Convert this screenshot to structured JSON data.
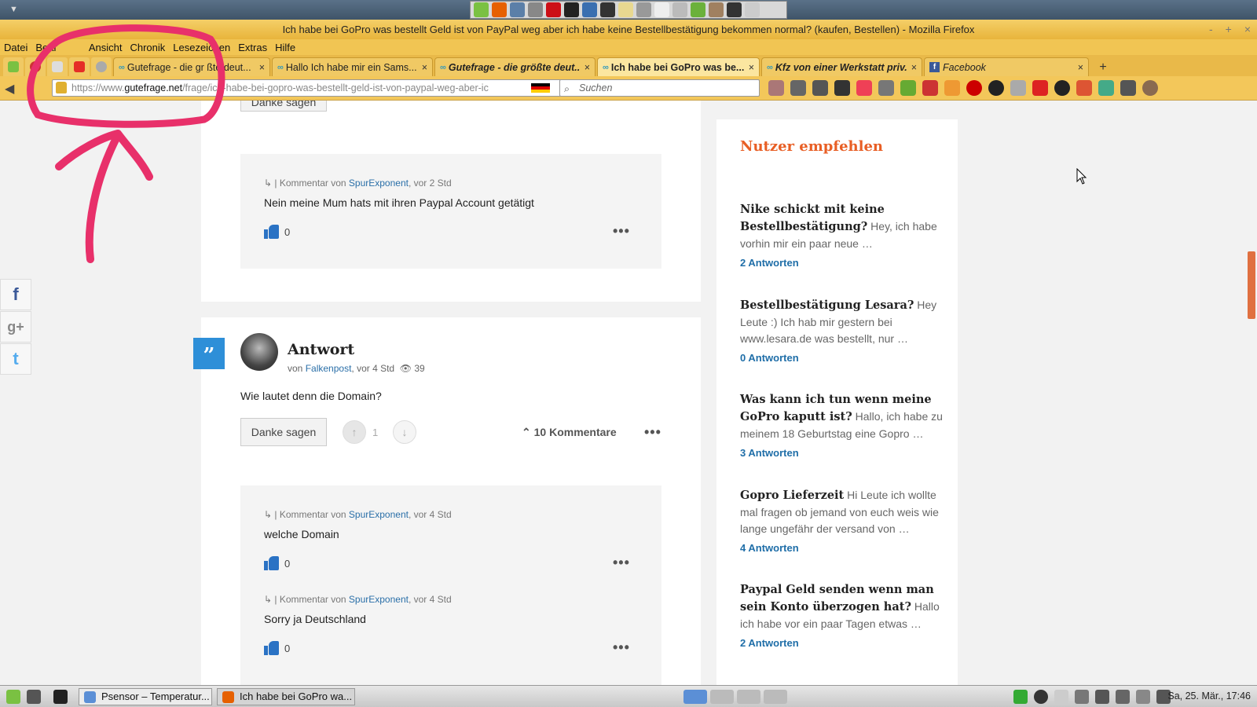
{
  "window": {
    "title": "Ich habe bei GoPro was bestellt Geld ist von PayPal weg aber ich habe keine Bestellbestätigung bekommen normal? (kaufen, Bestellen) - Mozilla Firefox",
    "controls": [
      "-",
      "+",
      "×"
    ]
  },
  "menu": [
    "Datei",
    "Bear",
    "Ansicht",
    "Chronik",
    "Lesezeichen",
    "Extras",
    "Hilfe"
  ],
  "tabs": [
    {
      "label": "Gutefrage - die gr  ßte deut...",
      "close": "×"
    },
    {
      "label": "Hallo Ich habe mir ein Sams...",
      "close": "×"
    },
    {
      "label": "Gutefrage - die größte deut...",
      "close": "×"
    },
    {
      "label": "Ich habe bei GoPro was be...",
      "close": "×"
    },
    {
      "label": "Kfz von einer Werkstatt priv...",
      "close": "×"
    },
    {
      "label": "Facebook",
      "close": "×"
    }
  ],
  "newtab": "+",
  "url": {
    "prefix": "https://www.",
    "host": "gutefrage.net",
    "path": "/frage/ich-habe-bei-gopro-was-bestellt-geld-ist-von-paypal-weg-aber-ic"
  },
  "search": {
    "placeholder": "Suchen"
  },
  "top_card": {
    "button": "Danke sagen"
  },
  "comments_top": [
    {
      "prefix": "↳ | Kommentar von",
      "user": "SpurExponent",
      "time": ", vor 2 Std",
      "text": "Nein meine Mum hats mit ihren Paypal Account getätigt",
      "likes": "0",
      "more": "•••"
    }
  ],
  "answer": {
    "badge": "”",
    "title": "Antwort",
    "by_prefix": "von",
    "user": "Falkenpost",
    "time": ", vor 4 Std",
    "views": "39",
    "text": "Wie lautet denn die Domain?",
    "thanks": "Danke sagen",
    "votes": "1",
    "comments_toggle": "10 Kommentare",
    "more": "•••"
  },
  "comments_bottom": [
    {
      "prefix": "↳ | Kommentar von",
      "user": "SpurExponent",
      "time": ", vor 4 Std",
      "text": "welche Domain",
      "likes": "0",
      "more": "•••"
    },
    {
      "prefix": "↳ | Kommentar von",
      "user": "SpurExponent",
      "time": ", vor 4 Std",
      "text": "Sorry ja Deutschland",
      "likes": "0",
      "more": "•••"
    }
  ],
  "share": [
    "f",
    "g+",
    "t"
  ],
  "sidebar": {
    "title": "Nutzer empfehlen",
    "items": [
      {
        "q": "Nike schickt mit keine Bestellbestätigung?",
        "t": " Hey, ich habe vorhin mir ein paar neue …",
        "a": "2 Antworten"
      },
      {
        "q": "Bestellbestätigung Lesara?",
        "t": " Hey Leute :) Ich hab mir gestern bei www.lesara.de was bestellt, nur …",
        "a": "0 Antworten"
      },
      {
        "q": "Was kann ich tun wenn meine GoPro kaputt ist?",
        "t": " Hallo, ich habe zu meinem 18 Geburtstag eine Gopro …",
        "a": "3 Antworten"
      },
      {
        "q": "Gopro Lieferzeit",
        "t": " Hi Leute ich wollte mal fragen ob jemand von euch weis wie lange ungefähr der versand von …",
        "a": "4 Antworten"
      },
      {
        "q": "Paypal Geld senden wenn man sein Konto überzogen hat?",
        "t": " Hallo ich habe vor ein paar Tagen etwas …",
        "a": "2 Antworten"
      }
    ]
  },
  "taskbar": {
    "windows": [
      "Psensor – Temperatur...",
      "Ich habe bei GoPro wa..."
    ],
    "clock": "Sa, 25. Mär., 17:46"
  },
  "colors": {
    "accent": "#e85e24",
    "link": "#1f6ea8",
    "annotation": "#e8306a"
  }
}
